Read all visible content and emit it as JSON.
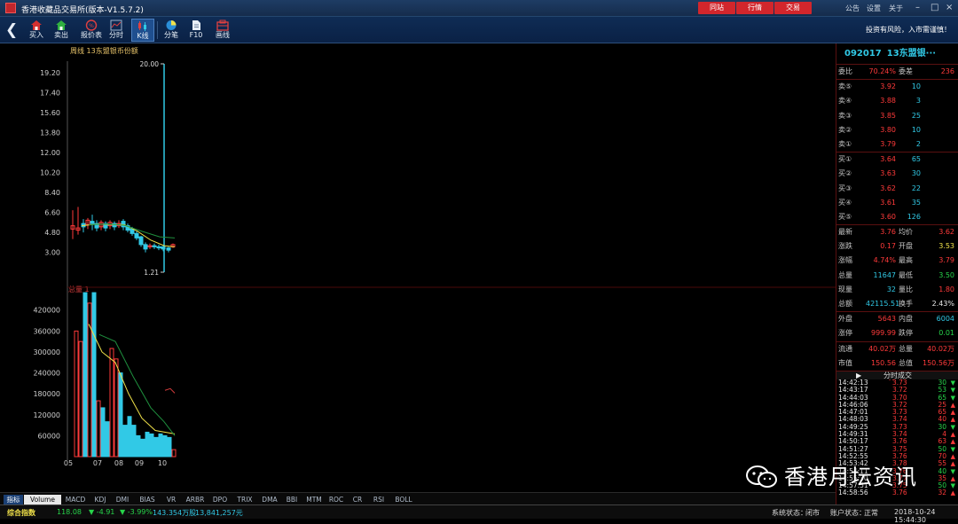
{
  "window": {
    "title": "香港收藏品交易所(版本-V1.5.7.2)",
    "buttons": [
      "同站",
      "行情",
      "交易"
    ],
    "links": [
      "公告",
      "设置",
      "关于"
    ]
  },
  "toolbar": {
    "items": [
      {
        "label": "买入",
        "icon": "buy-icon"
      },
      {
        "label": "卖出",
        "icon": "sell-icon"
      },
      {
        "label": "报价表",
        "icon": "quote-table-icon"
      },
      {
        "label": "分时",
        "icon": "timeshare-icon"
      },
      {
        "label": "K线",
        "icon": "kline-icon"
      },
      {
        "label": "分笔",
        "icon": "tick-icon"
      },
      {
        "label": "F10",
        "icon": "f10-icon"
      },
      {
        "label": "画线",
        "icon": "draw-line-icon"
      }
    ],
    "risk_notice": "投资有风险，入市需谨慎！"
  },
  "chart": {
    "price_title": "周线  13东盟银币份额",
    "volume_title": "总量  1",
    "max_label": "20.00",
    "min_label": "1.21",
    "x_labels": [
      "05",
      "07",
      "08",
      "09",
      "10"
    ]
  },
  "chart_data": [
    {
      "type": "candlestick",
      "title": "周线  13东盟银币份额",
      "ylim": [
        1.21,
        20.0
      ],
      "yticks": [
        19.2,
        17.4,
        15.6,
        13.8,
        12.0,
        10.2,
        8.4,
        6.6,
        4.8,
        3.0
      ],
      "x_labels": [
        "05",
        "07",
        "08",
        "09",
        "10"
      ],
      "marked_high": 20.0,
      "marked_low": 1.21
    },
    {
      "type": "bar",
      "title": "总量  1",
      "yticks": [
        420000,
        360000,
        300000,
        240000,
        180000,
        120000,
        60000
      ],
      "x_labels": [
        "05",
        "07",
        "08",
        "09",
        "10"
      ]
    }
  ],
  "quote": {
    "code": "092017",
    "name": "13东盟银···",
    "weibi_label": "委比",
    "weibi": "70.24%",
    "weicha_label": "委差",
    "weicha": "236",
    "sell": [
      {
        "label": "卖⑤",
        "price": "3.92",
        "qty": "10"
      },
      {
        "label": "卖④",
        "price": "3.88",
        "qty": "3"
      },
      {
        "label": "卖③",
        "price": "3.85",
        "qty": "25"
      },
      {
        "label": "卖②",
        "price": "3.80",
        "qty": "10"
      },
      {
        "label": "卖①",
        "price": "3.79",
        "qty": "2"
      }
    ],
    "buy": [
      {
        "label": "买①",
        "price": "3.64",
        "qty": "65"
      },
      {
        "label": "买②",
        "price": "3.63",
        "qty": "30"
      },
      {
        "label": "买③",
        "price": "3.62",
        "qty": "22"
      },
      {
        "label": "买④",
        "price": "3.61",
        "qty": "35"
      },
      {
        "label": "买⑤",
        "price": "3.60",
        "qty": "126"
      }
    ],
    "stats": [
      {
        "l1": "最新",
        "v1": "3.76",
        "c1": "red",
        "l2": "均价",
        "v2": "3.62",
        "c2": "red"
      },
      {
        "l1": "涨跌",
        "v1": "0.17",
        "c1": "red",
        "l2": "开盘",
        "v2": "3.53",
        "c2": "yel"
      },
      {
        "l1": "涨幅",
        "v1": "4.74%",
        "c1": "red",
        "l2": "最高",
        "v2": "3.79",
        "c2": "red"
      },
      {
        "l1": "总量",
        "v1": "11647",
        "c1": "cyan",
        "l2": "最低",
        "v2": "3.50",
        "c2": "grn"
      },
      {
        "l1": "现量",
        "v1": "32",
        "c1": "cyan",
        "l2": "量比",
        "v2": "1.80",
        "c2": "red"
      },
      {
        "l1": "总额",
        "v1": "42115.51",
        "c1": "cyan",
        "l2": "换手",
        "v2": "2.43%",
        "c2": "wht"
      }
    ],
    "stats2": [
      {
        "l1": "外盘",
        "v1": "5643",
        "c1": "red",
        "l2": "内盘",
        "v2": "6004",
        "c2": "cyan"
      },
      {
        "l1": "涨停",
        "v1": "999.99",
        "c1": "red",
        "l2": "跌停",
        "v2": "0.01",
        "c2": "grn"
      }
    ],
    "stats3": [
      {
        "l1": "流通",
        "v1": "40.02万",
        "c1": "red",
        "l2": "总量",
        "v2": "40.02万",
        "c2": "red"
      },
      {
        "l1": "市值",
        "v1": "150.56万",
        "c1": "red",
        "l2": "总值",
        "v2": "150.56万",
        "c2": "red"
      }
    ],
    "trades_header": "分时成交",
    "trades": [
      {
        "time": "14:42:13",
        "price": "3.73",
        "vol": "30",
        "dir": "down"
      },
      {
        "time": "14:43:17",
        "price": "3.72",
        "vol": "53",
        "dir": "down"
      },
      {
        "time": "14:44:03",
        "price": "3.70",
        "vol": "65",
        "dir": "down"
      },
      {
        "time": "14:46:06",
        "price": "3.72",
        "vol": "25",
        "dir": "up"
      },
      {
        "time": "14:47:01",
        "price": "3.73",
        "vol": "65",
        "dir": "up"
      },
      {
        "time": "14:48:03",
        "price": "3.74",
        "vol": "40",
        "dir": "up"
      },
      {
        "time": "14:49:25",
        "price": "3.73",
        "vol": "30",
        "dir": "down"
      },
      {
        "time": "14:49:31",
        "price": "3.74",
        "vol": "4",
        "dir": "up"
      },
      {
        "time": "14:50:17",
        "price": "3.76",
        "vol": "63",
        "dir": "up"
      },
      {
        "time": "14:51:27",
        "price": "3.75",
        "vol": "50",
        "dir": "down"
      },
      {
        "time": "14:52:55",
        "price": "3.76",
        "vol": "70",
        "dir": "up"
      },
      {
        "time": "14:53:42",
        "price": "3.78",
        "vol": "55",
        "dir": "up"
      },
      {
        "time": "14:54:11",
        "price": "3.76",
        "vol": "40",
        "dir": "down"
      },
      {
        "time": "14:55:30",
        "price": "3.77",
        "vol": "35",
        "dir": "up"
      },
      {
        "time": "14:57:51",
        "price": "3.75",
        "vol": "50",
        "dir": "down"
      },
      {
        "time": "14:58:56",
        "price": "3.76",
        "vol": "32",
        "dir": "up"
      }
    ]
  },
  "indicator_tabs": [
    "指标",
    "Volume",
    "MACD",
    "KDJ",
    "DMI",
    "BIAS",
    "VR",
    "ARBR",
    "DPO",
    "TRIX",
    "DMA",
    "BBI",
    "MTM",
    "ROC",
    "CR",
    "RSI",
    "BOLL"
  ],
  "status": {
    "index_name": "综合指数",
    "index_value": "118.08",
    "change": "▼ -4.91",
    "pct": "▼ -3.99%",
    "amount": "143.354万股",
    "turnover": "13,841,257元",
    "system_label": "系统状态：",
    "system_value": "闭市",
    "account_label": "账户状态：",
    "account_value": "正常",
    "datetime": "2018-10-24 15:44:30"
  },
  "watermark": "香港月坛资讯",
  "colors": {
    "up": "#ff3a3a",
    "down": "#31c9e6",
    "ma5": "#f1e24a",
    "ma10": "#1f8f3e"
  }
}
